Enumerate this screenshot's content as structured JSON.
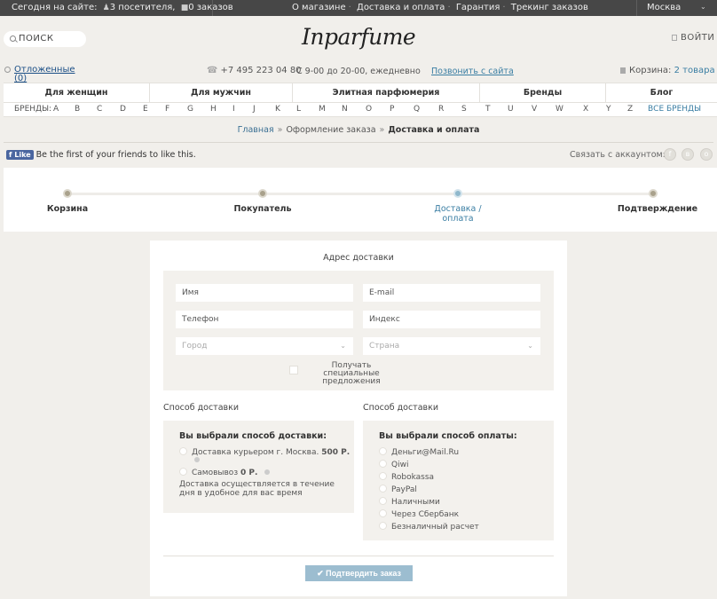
{
  "topbar": {
    "online_prefix": "Сегодня на сайте:",
    "visitors": "3 посетителя,",
    "orders": "0 заказов",
    "menu": [
      "О магазине",
      "Доставка и оплата",
      "Гарантия",
      "Трекинг заказов"
    ],
    "city": "Москва"
  },
  "header": {
    "search_label": "ПОИСК",
    "logo": "Inparfume",
    "login": "ВОЙТИ",
    "deferred_label": "Отложенные",
    "deferred_count": "(0)",
    "phone": "+7 495 223 04 80",
    "hours": "С 9-00 до 20-00, ежедневно",
    "callback": "Позвонить с сайта",
    "cart_label": "Корзина:",
    "cart_items": "2 товара"
  },
  "nav": [
    "Для женщин",
    "Для мужчин",
    "Элитная парфюмерия",
    "Бренды",
    "Блог"
  ],
  "brands": {
    "label": "БРЕНДЫ:",
    "letters": [
      "A",
      "B",
      "C",
      "D",
      "E",
      "F",
      "G",
      "H",
      "I",
      "J",
      "K",
      "L",
      "M",
      "N",
      "O",
      "P",
      "Q",
      "R",
      "S",
      "T",
      "U",
      "V",
      "W",
      "X",
      "Y",
      "Z"
    ],
    "all": "ВСЕ БРЕНДЫ"
  },
  "breadcrumb": {
    "home": "Главная",
    "order": "Оформление заказа",
    "current": "Доставка и оплата"
  },
  "social": {
    "like": "Like",
    "like_text": "Be the first of your friends to like this.",
    "link_account": "Связать с аккаунтом:"
  },
  "steps": [
    {
      "label": "Корзина",
      "active": false
    },
    {
      "label": "Покупатель",
      "active": false
    },
    {
      "label": "Доставка /\nоплата",
      "active": true
    },
    {
      "label": "Подтверждение",
      "active": false
    }
  ],
  "form": {
    "title": "Адрес доставки",
    "name_placeholder": "Имя",
    "email_placeholder": "E-mail",
    "phone_placeholder": "Телефон",
    "index_placeholder": "Индекс",
    "city_placeholder": "Город",
    "country_placeholder": "Страна",
    "offers_label": "Получать специальные предложения"
  },
  "delivery": {
    "title": "Способ доставки",
    "heading": "Вы выбрали способ доставки:",
    "courier": "Доставка курьером г. Москва.",
    "courier_price": "500 Р.",
    "pickup": "Самовывоз",
    "pickup_price": "0 Р.",
    "note": "Доставка осуществляется в течение дня в удобное для вас время"
  },
  "payment": {
    "title": "Способ доставки",
    "heading": "Вы выбрали способ оплаты:",
    "options": [
      "Деньги@Mail.Ru",
      "Qiwi",
      "Robokassa",
      "PayPal",
      "Наличными",
      "Через Сбербанк",
      "Безналичный расчет"
    ]
  },
  "confirm_label": "✔ Подтвердить заказ",
  "colors": {
    "accent": "#3a7ea3",
    "topbar": "#474747",
    "button": "#9cbdd0"
  }
}
